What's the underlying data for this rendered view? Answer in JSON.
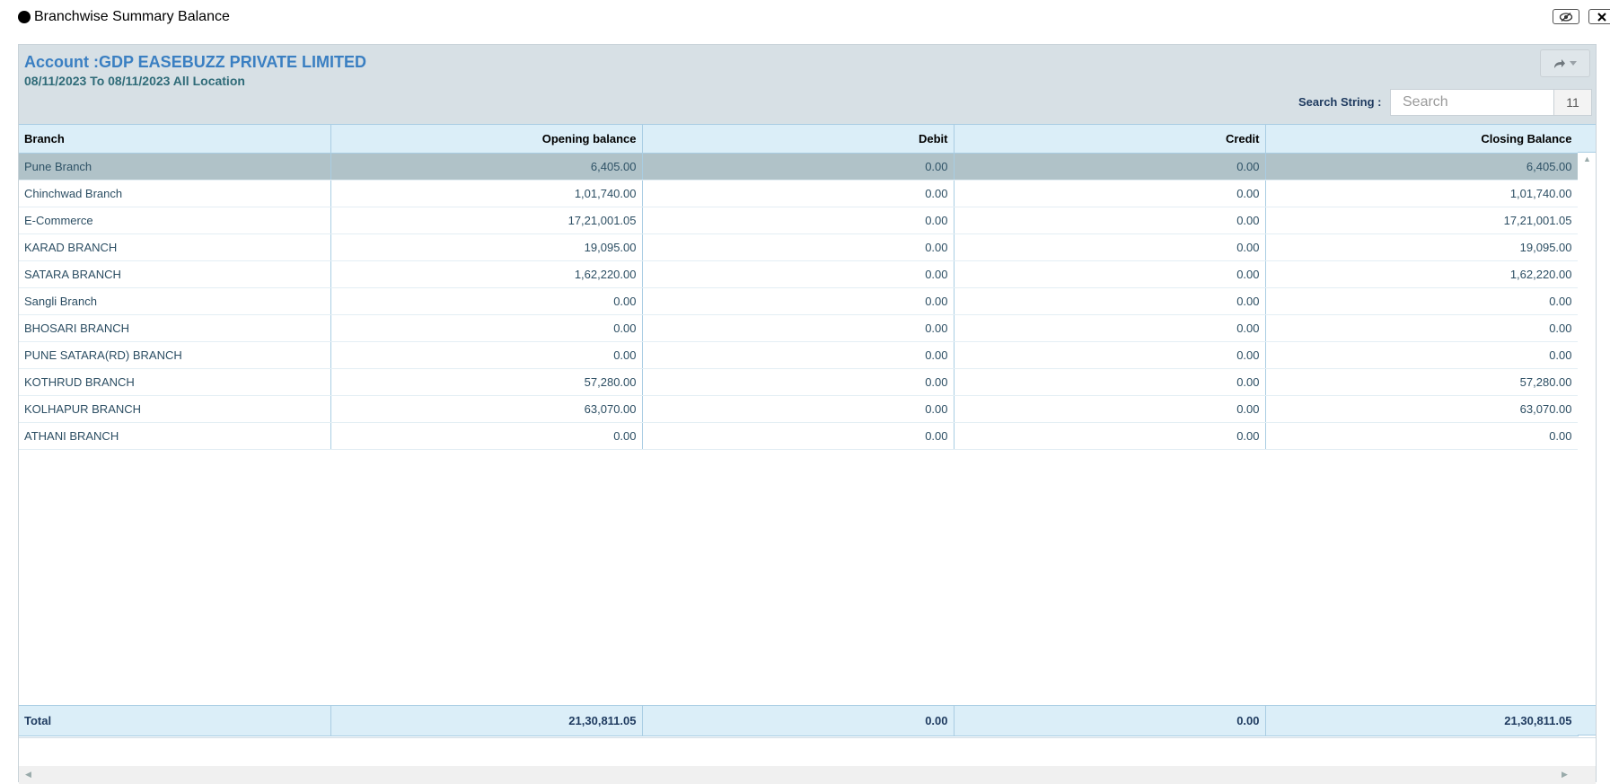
{
  "window": {
    "title": "Branchwise Summary Balance"
  },
  "header": {
    "account": "Account :GDP EASEBUZZ PRIVATE LIMITED",
    "date_range": "08/11/2023 To 08/11/2023 All Location",
    "search_label": "Search String :",
    "search_placeholder": "Search",
    "search_count": "11"
  },
  "table": {
    "columns": [
      "Branch",
      "Opening balance",
      "Debit",
      "Credit",
      "Closing Balance"
    ],
    "rows": [
      [
        "Pune Branch",
        "6,405.00",
        "0.00",
        "0.00",
        "6,405.00"
      ],
      [
        "Chinchwad Branch",
        "1,01,740.00",
        "0.00",
        "0.00",
        "1,01,740.00"
      ],
      [
        "E-Commerce",
        "17,21,001.05",
        "0.00",
        "0.00",
        "17,21,001.05"
      ],
      [
        "KARAD BRANCH",
        "19,095.00",
        "0.00",
        "0.00",
        "19,095.00"
      ],
      [
        "SATARA BRANCH",
        "1,62,220.00",
        "0.00",
        "0.00",
        "1,62,220.00"
      ],
      [
        "Sangli Branch",
        "0.00",
        "0.00",
        "0.00",
        "0.00"
      ],
      [
        "BHOSARI BRANCH",
        "0.00",
        "0.00",
        "0.00",
        "0.00"
      ],
      [
        "PUNE SATARA(RD) BRANCH",
        "0.00",
        "0.00",
        "0.00",
        "0.00"
      ],
      [
        "KOTHRUD BRANCH",
        "57,280.00",
        "0.00",
        "0.00",
        "57,280.00"
      ],
      [
        "KOLHAPUR BRANCH",
        "63,070.00",
        "0.00",
        "0.00",
        "63,070.00"
      ],
      [
        "ATHANI BRANCH",
        "0.00",
        "0.00",
        "0.00",
        "0.00"
      ]
    ],
    "selected_row": 0,
    "total": [
      "Total",
      "21,30,811.05",
      "0.00",
      "0.00",
      "21,30,811.05"
    ]
  },
  "colors": {
    "accent": "#3a7fc2",
    "header_bg": "#d7e0e5",
    "grid_header_bg": "#dbeef8",
    "selected_row_bg": "#b0c2c8"
  },
  "icons": {
    "eye_toggle": "eye-slash-icon",
    "close": "close-icon",
    "share": "share-icon"
  }
}
